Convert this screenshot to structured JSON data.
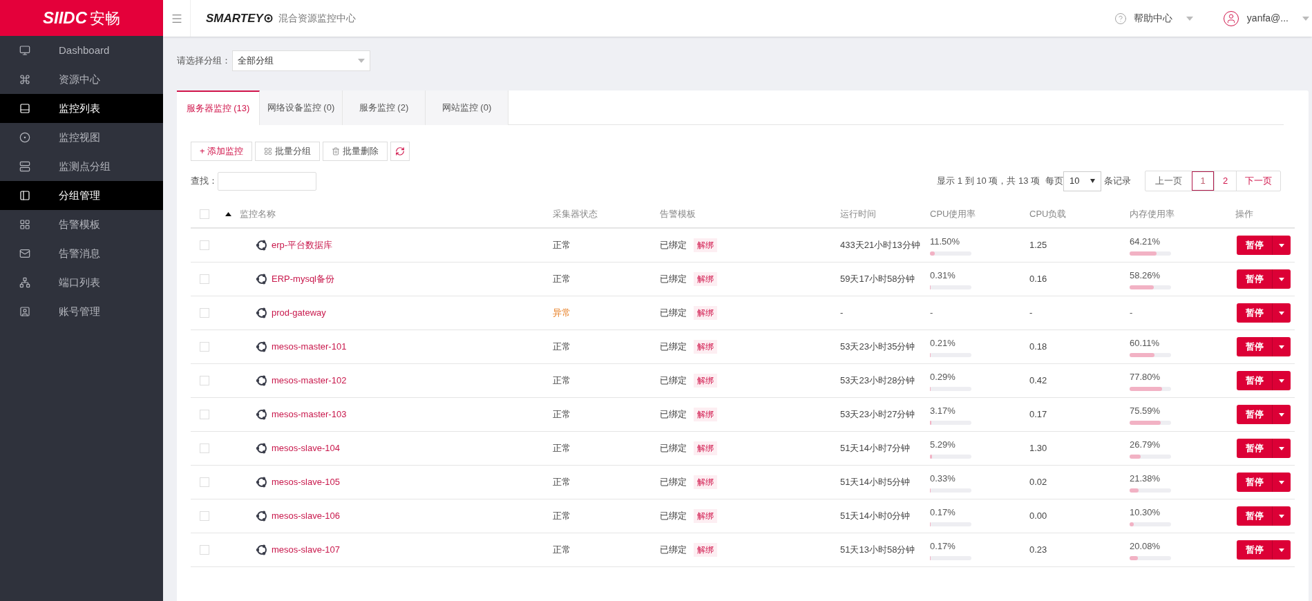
{
  "logo": {
    "brand": "SIIDC",
    "name": "安畅"
  },
  "header": {
    "product": "SMARTEY",
    "subtitle": "混合资源监控中心",
    "help": "帮助中心",
    "user": "yanfa@..."
  },
  "sidebar": {
    "items": [
      {
        "label": "Dashboard",
        "selected": false
      },
      {
        "label": "资源中心",
        "selected": false
      },
      {
        "label": "监控列表",
        "selected": true
      },
      {
        "label": "监控视图",
        "selected": false
      },
      {
        "label": "监测点分组",
        "selected": false
      },
      {
        "label": "分组管理",
        "selected": true
      },
      {
        "label": "告警模板",
        "selected": false
      },
      {
        "label": "告警消息",
        "selected": false
      },
      {
        "label": "端口列表",
        "selected": false
      },
      {
        "label": "账号管理",
        "selected": false
      }
    ]
  },
  "group_filter": {
    "label": "请选择分组：",
    "value": "全部分组"
  },
  "tabs": [
    {
      "label": "服务器监控 (13)",
      "selected": true
    },
    {
      "label": "网络设备监控 (0)",
      "selected": false
    },
    {
      "label": "服务监控 (2)",
      "selected": false
    },
    {
      "label": "网站监控 (0)",
      "selected": false
    }
  ],
  "toolbar": {
    "add": "+ 添加监控",
    "group": "批量分组",
    "delete": "批量删除"
  },
  "search": {
    "label": "查找："
  },
  "paging": {
    "info": "显示 1 到 10 项，共 13 项",
    "per_page_label": "每页",
    "per_page": "10",
    "records_label": "条记录",
    "prev": "上一页",
    "next": "下一页",
    "pages": [
      {
        "label": "1",
        "selected": true
      },
      {
        "label": "2",
        "selected": false
      }
    ]
  },
  "table": {
    "columns": [
      "监控名称",
      "采集器状态",
      "告警模板",
      "运行时间",
      "CPU使用率",
      "CPU负载",
      "内存使用率",
      "操作"
    ],
    "select_all": {
      "checked": false
    },
    "rows": [
      {
        "checked": false,
        "name": "erp-平台数据库",
        "status": "正常",
        "abnormal": false,
        "template": "已绑定",
        "unbind": "解绑",
        "uptime": "433天21小时13分钟",
        "cpu": "11.50%",
        "cpu_bar": {
          "level": 0.115
        },
        "load": "1.25",
        "mem": "64.21%",
        "mem_bar": {
          "level": 0.6421
        },
        "action": "暂停"
      },
      {
        "checked": false,
        "name": "ERP-mysql备份",
        "status": "正常",
        "abnormal": false,
        "template": "已绑定",
        "unbind": "解绑",
        "uptime": "59天17小时58分钟",
        "cpu": "0.31%",
        "cpu_bar": {
          "level": 0.0031
        },
        "load": "0.16",
        "mem": "58.26%",
        "mem_bar": {
          "level": 0.5826
        },
        "action": "暂停"
      },
      {
        "checked": false,
        "name": "prod-gateway",
        "status": "异常",
        "abnormal": true,
        "template": "已绑定",
        "unbind": "解绑",
        "uptime": "-",
        "cpu": "-",
        "load": "-",
        "mem": "-",
        "action": "暂停"
      },
      {
        "checked": false,
        "name": "mesos-master-101",
        "status": "正常",
        "abnormal": false,
        "template": "已绑定",
        "unbind": "解绑",
        "uptime": "53天23小时35分钟",
        "cpu": "0.21%",
        "cpu_bar": {
          "level": 0.0021
        },
        "load": "0.18",
        "mem": "60.11%",
        "mem_bar": {
          "level": 0.6011
        },
        "action": "暂停"
      },
      {
        "checked": false,
        "name": "mesos-master-102",
        "status": "正常",
        "abnormal": false,
        "template": "已绑定",
        "unbind": "解绑",
        "uptime": "53天23小时28分钟",
        "cpu": "0.29%",
        "cpu_bar": {
          "level": 0.0029
        },
        "load": "0.42",
        "mem": "77.80%",
        "mem_bar": {
          "level": 0.778
        },
        "action": "暂停"
      },
      {
        "checked": false,
        "name": "mesos-master-103",
        "status": "正常",
        "abnormal": false,
        "template": "已绑定",
        "unbind": "解绑",
        "uptime": "53天23小时27分钟",
        "cpu": "3.17%",
        "cpu_bar": {
          "level": 0.0317
        },
        "load": "0.17",
        "mem": "75.59%",
        "mem_bar": {
          "level": 0.7559
        },
        "action": "暂停"
      },
      {
        "checked": false,
        "name": "mesos-slave-104",
        "status": "正常",
        "abnormal": false,
        "template": "已绑定",
        "unbind": "解绑",
        "uptime": "51天14小时7分钟",
        "cpu": "5.29%",
        "cpu_bar": {
          "level": 0.0529
        },
        "load": "1.30",
        "mem": "26.79%",
        "mem_bar": {
          "level": 0.2679
        },
        "action": "暂停"
      },
      {
        "checked": false,
        "name": "mesos-slave-105",
        "status": "正常",
        "abnormal": false,
        "template": "已绑定",
        "unbind": "解绑",
        "uptime": "51天14小时5分钟",
        "cpu": "0.33%",
        "cpu_bar": {
          "level": 0.0033
        },
        "load": "0.02",
        "mem": "21.38%",
        "mem_bar": {
          "level": 0.2138
        },
        "action": "暂停"
      },
      {
        "checked": false,
        "name": "mesos-slave-106",
        "status": "正常",
        "abnormal": false,
        "template": "已绑定",
        "unbind": "解绑",
        "uptime": "51天14小时0分钟",
        "cpu": "0.17%",
        "cpu_bar": {
          "level": 0.0017
        },
        "load": "0.00",
        "mem": "10.30%",
        "mem_bar": {
          "level": 0.103
        },
        "action": "暂停"
      },
      {
        "checked": false,
        "name": "mesos-slave-107",
        "status": "正常",
        "abnormal": false,
        "template": "已绑定",
        "unbind": "解绑",
        "uptime": "51天13小时58分钟",
        "cpu": "0.17%",
        "cpu_bar": {
          "level": 0.0017
        },
        "load": "0.23",
        "mem": "20.08%",
        "mem_bar": {
          "level": 0.2008
        },
        "action": "暂停"
      }
    ]
  }
}
